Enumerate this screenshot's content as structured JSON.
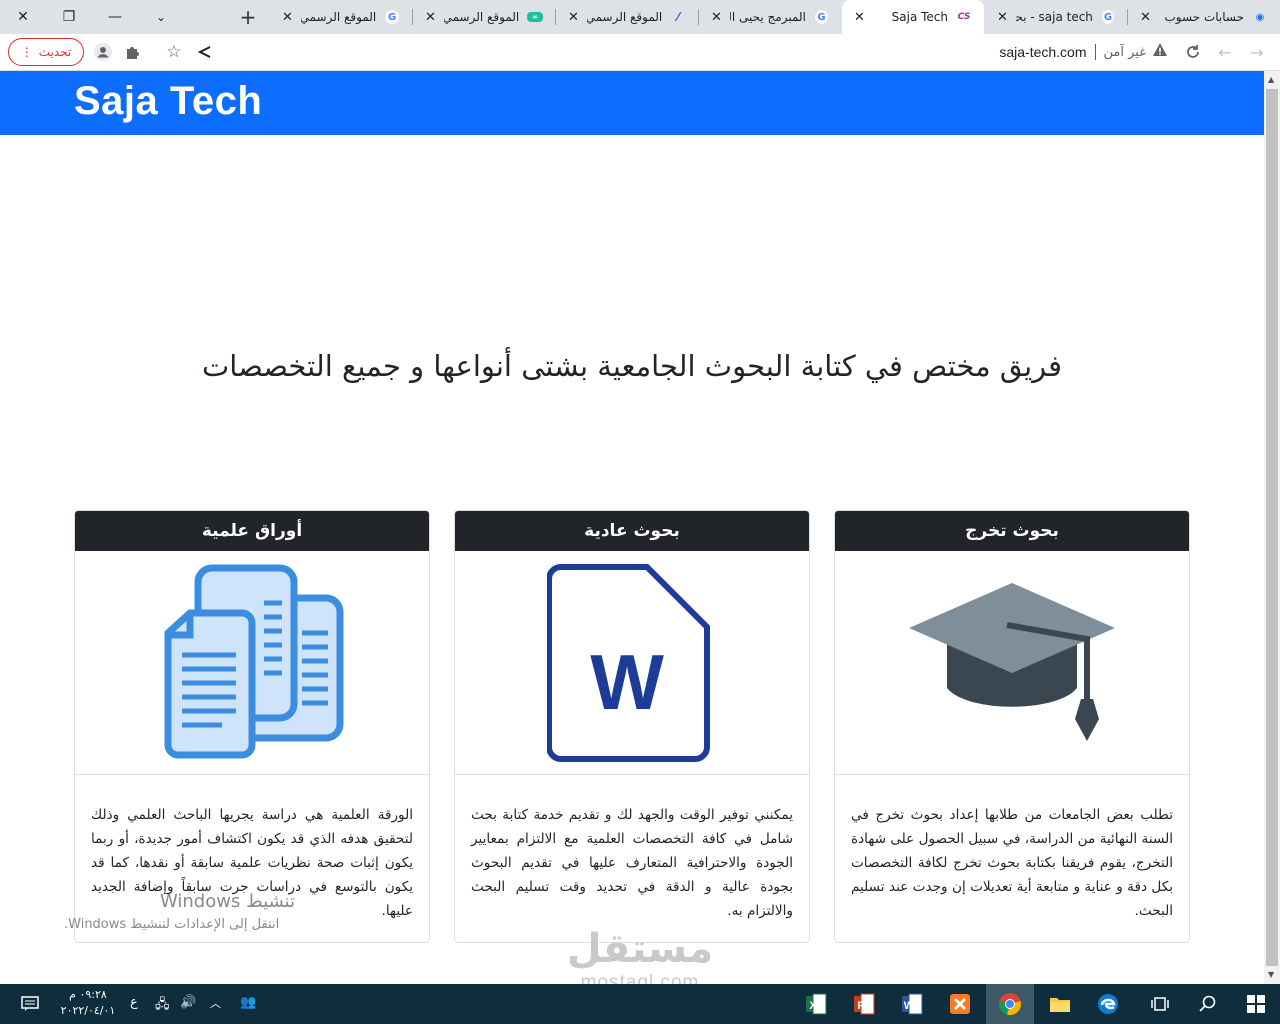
{
  "browser": {
    "tabs": [
      {
        "title": "حسابات حسوب",
        "favicon": "hsoub-icon",
        "fav_color": "#1b72e8",
        "active": false
      },
      {
        "title": "saja tech - بحث",
        "favicon": "google-icon",
        "fav_color": "#ffffff",
        "active": false
      },
      {
        "title": "Saja Tech",
        "favicon": "css-icon",
        "fav_color": "#ffffff",
        "active": true
      },
      {
        "title": "المبرمج يحيى الـ",
        "favicon": "google-icon",
        "fav_color": "#ffffff",
        "active": false
      },
      {
        "title": "الموقع الرسمي",
        "favicon": "wordpress-icon",
        "fav_color": "#ffffff",
        "active": false
      },
      {
        "title": "الموقع الرسمي",
        "favicon": "site-icon",
        "fav_color": "#18c29c",
        "active": false
      },
      {
        "title": "الموقع الرسمي",
        "favicon": "google-icon",
        "fav_color": "#ffffff",
        "active": false
      }
    ],
    "address": {
      "security_label": "غير آمن",
      "url": "saja-tech.com"
    },
    "update_button": "تحديث"
  },
  "page": {
    "brand": "Saja Tech",
    "brand_color": "#0d6efd",
    "hero": "فريق مختص في كتابة البحوث الجامعية بشتى أنواعها و جميع التخصصات",
    "cards": [
      {
        "title": "أوراق علمية",
        "icon": "documents-icon",
        "text": "الورقة العلمية هي دراسة يجريها الباحث العلمي وذلك لتحقيق هدفه الذي قد يكون اكتشاف أمور جديدة، أو ربما يكون إثبات صحة نظريات علمية سابقة أو نقدها، كما قد يكون بالتوسع في دراسات جرت سابقاً وإضافة الجديد عليها."
      },
      {
        "title": "بحوث عادية",
        "icon": "word-document-icon",
        "text": "يمكنني توفير الوقت والجهد لك و تقديم خدمة كتابة بحث شامل في كافة التخصصات العلمية مع الالتزام بمعايير الجودة والاحترافية المتعارف عليها في تقديم البحوث بجودة عالية و الدقة في تحديد وقت تسليم البحث والالتزام به."
      },
      {
        "title": "بحوث تخرج",
        "icon": "graduation-cap-icon",
        "text": "تطلب بعض الجامعات من طلابها إعداد بحوث تخرج في السنة النهائية من الدراسة، في سبيل الحصول على شهادة التخرج، يقوم فريقنا بكتابة بحوث تخرج لكافة التخصصات بكل دقة و عناية و متابعة أية تعديلات إن وجدت عند تسليم البحث."
      }
    ]
  },
  "overlay": {
    "activate_title": "تنشيط Windows",
    "activate_sub": "انتقل إلى الإعدادات لتنشيط Windows.",
    "watermark_ar": "مستقل",
    "watermark_en": "mostaql.com"
  },
  "taskbar": {
    "time": "٠٩:٢٨ م",
    "date": "٢٠٢٢/٠٤/٠١",
    "lang": "ع",
    "apps": [
      "excel-icon",
      "powerpoint-icon",
      "word-icon",
      "xampp-icon",
      "chrome-icon",
      "file-explorer-icon",
      "edge-icon",
      "task-view-icon",
      "search-icon",
      "windows-start-icon"
    ]
  }
}
